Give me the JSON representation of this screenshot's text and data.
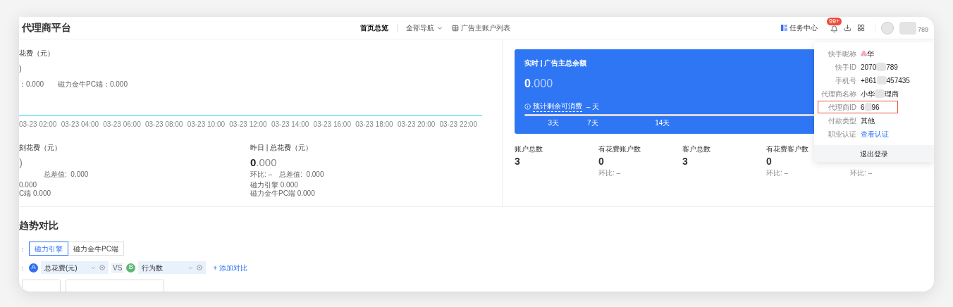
{
  "header": {
    "title": "代理商平台",
    "nav": [
      {
        "label": "首页总览",
        "selected": true,
        "kind": "plain"
      },
      {
        "label": "全部导航",
        "selected": false,
        "kind": "dropdown"
      },
      {
        "label": "广告主账户列表",
        "selected": false,
        "kind": "icon"
      }
    ],
    "task_center": "任务中心",
    "notification_badge": "99+",
    "user_id_tail": "789"
  },
  "spend_card": {
    "title": "花费（元）",
    "value": ")",
    "breakdown": [
      {
        "label": "：",
        "value": "0.000"
      },
      {
        "label": "磁力金牛PC端：",
        "value": "0.000"
      }
    ],
    "x_labels": [
      "03-23 02:00",
      "03-23 04:00",
      "03-23 06:00",
      "03-23 08:00",
      "03-23 10:00",
      "03-23 12:00",
      "03-23 14:00",
      "03-23 16:00",
      "03-23 18:00",
      "03-23 20:00",
      "03-23 22:00"
    ]
  },
  "period_cards": [
    {
      "title": "刻花费（元）",
      "value_decimal": ")",
      "diff_label": "总差值:",
      "diff_value": "0.000",
      "lines": [
        {
          "value": "0.000"
        },
        {
          "label": "C端",
          "value": "0.000"
        }
      ]
    },
    {
      "title": "昨日 | 总花费（元）",
      "value_main": "0",
      "value_decimal": ".000",
      "ratio_label": "环比:",
      "ratio_value": "–",
      "diff_label": "总差值:",
      "diff_value": "0.000",
      "lines": [
        {
          "label": "磁力引擎",
          "value": "0.000"
        },
        {
          "label": "磁力金牛PC端",
          "value": "0.000"
        }
      ]
    }
  ],
  "balance_card": {
    "title": "实时 | 广告主总余额",
    "value_main": "0",
    "value_decimal": ".000",
    "forecast_label": "预计剩余可消费",
    "forecast_value": "–",
    "forecast_unit": "天",
    "ticks": [
      {
        "label": "3天",
        "level": 0.1
      },
      {
        "label": "7天",
        "level": 0.235
      },
      {
        "label": "14天",
        "level": 0.475
      }
    ]
  },
  "stats": [
    {
      "label": "账户总数",
      "value": "3"
    },
    {
      "label": "有花费账户数",
      "value": "0",
      "ratio": "环比: –"
    },
    {
      "label": "客户总数",
      "value": "3"
    },
    {
      "label": "有花费客户数",
      "value": "0",
      "ratio": "环比: –"
    },
    {
      "ratio": "环比: –"
    }
  ],
  "trend": {
    "title": "趋势对比",
    "segment_prefix": "：",
    "segments": [
      {
        "label": "磁力引擎",
        "selected": true
      },
      {
        "label": "磁力金牛PC端",
        "selected": false
      }
    ],
    "compare_prefix": "：",
    "metrics": [
      {
        "badge": "A",
        "label": "总花费(元)",
        "color": "#2f6ff0"
      },
      {
        "badge": "B",
        "label": "行为数",
        "color": "#5bb978"
      }
    ],
    "vs": "VS",
    "add_compare": "+ 添加对比"
  },
  "profile_popup": {
    "rows": [
      {
        "label": "快手昵称",
        "parts": [
          "华"
        ],
        "kind": "nickname",
        "highlighted": false,
        "redacted": false
      },
      {
        "label": "快手ID",
        "parts": [
          "2070",
          "789"
        ],
        "kind": "text",
        "highlighted": false,
        "redacted": true
      },
      {
        "label": "手机号",
        "parts": [
          "+861",
          "457435"
        ],
        "kind": "text",
        "highlighted": false,
        "redacted": true
      },
      {
        "label": "代理商名称",
        "parts": [
          "小华",
          "理商"
        ],
        "kind": "text",
        "highlighted": false,
        "redacted": true
      },
      {
        "label": "代理商ID",
        "parts": [
          "6",
          "96"
        ],
        "kind": "text",
        "highlighted": true,
        "redacted": true
      },
      {
        "label": "付款类型",
        "parts": [
          "其他"
        ],
        "kind": "text",
        "highlighted": false,
        "redacted": false
      },
      {
        "label": "职业认证",
        "parts": [
          "查看认证"
        ],
        "kind": "link",
        "highlighted": false,
        "redacted": false
      }
    ],
    "logout": "退出登录"
  }
}
